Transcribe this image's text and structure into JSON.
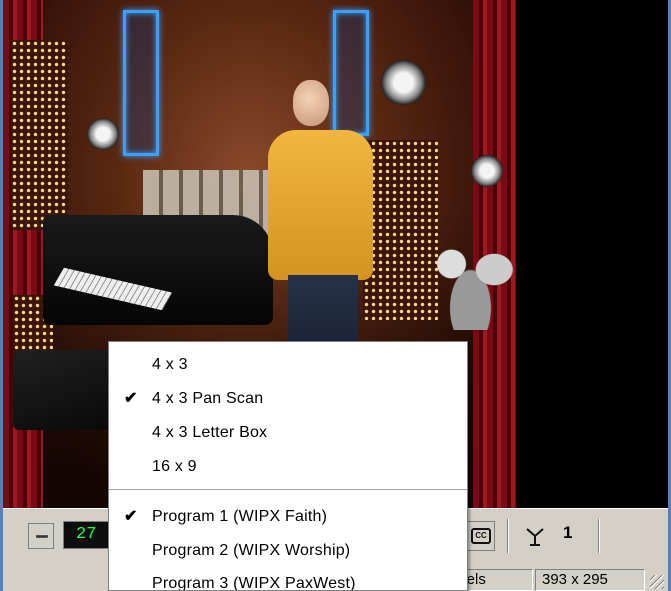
{
  "video": {
    "description_icon": "video-frame"
  },
  "toolbar": {
    "channel_number": "27",
    "cc_label": "CC",
    "antenna_count": "1"
  },
  "statusbar": {
    "channels_text": "nnels",
    "resolution": "393 x 295"
  },
  "menu": {
    "aspect_items": [
      {
        "label": "4 x 3",
        "checked": false
      },
      {
        "label": "4 x 3 Pan Scan",
        "checked": true
      },
      {
        "label": "4 x 3 Letter Box",
        "checked": false
      },
      {
        "label": "16 x 9",
        "checked": false
      }
    ],
    "program_items": [
      {
        "label": "Program 1 (WIPX Faith)",
        "checked": true
      },
      {
        "label": "Program 2 (WIPX Worship)",
        "checked": false
      },
      {
        "label": "Program 3 (WIPX PaxWest)",
        "checked": false
      }
    ],
    "check_glyph": "✔"
  },
  "colors": {
    "channel_digits": "#22ff44",
    "window_border": "#5a7fbf",
    "chrome": "#d4d0c8"
  }
}
